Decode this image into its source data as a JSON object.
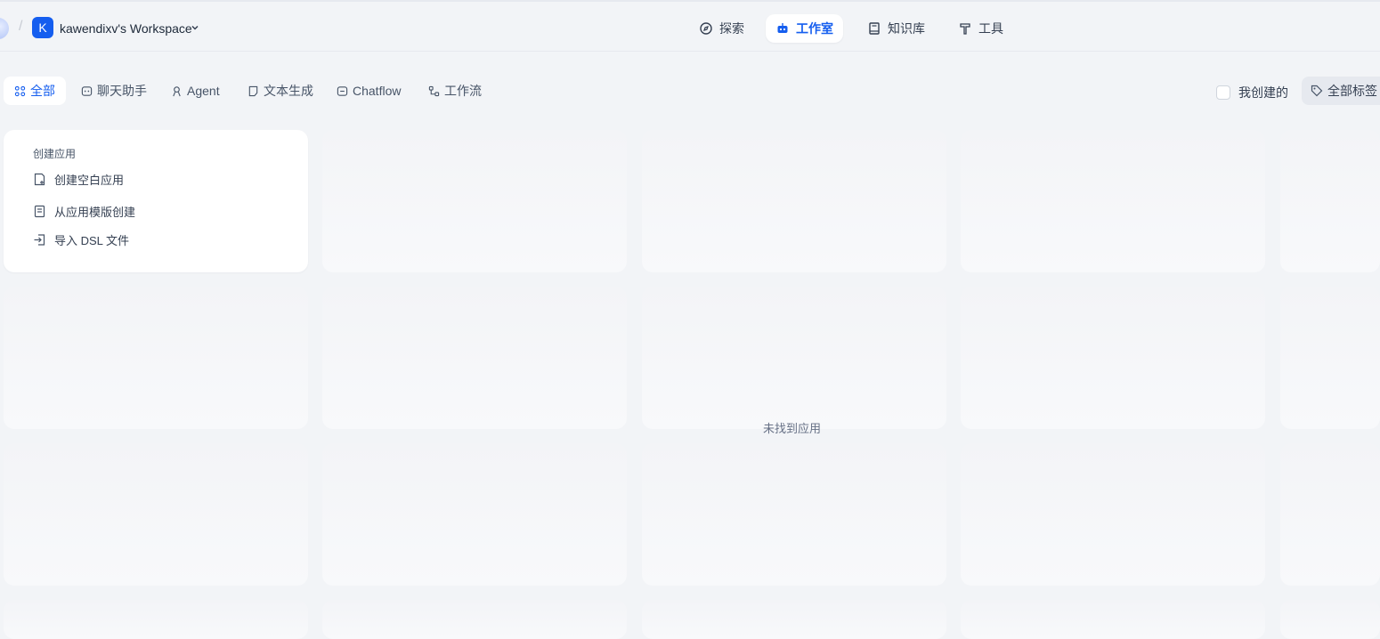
{
  "header": {
    "workspace_initial": "K",
    "workspace_name": "kawendixv's Workspace",
    "nav": [
      {
        "label": "探索",
        "icon": "compass-icon",
        "active": false
      },
      {
        "label": "工作室",
        "icon": "robot-icon",
        "active": true
      },
      {
        "label": "知识库",
        "icon": "book-icon",
        "active": false
      },
      {
        "label": "工具",
        "icon": "hammer-icon",
        "active": false
      }
    ]
  },
  "filters": {
    "tabs": [
      {
        "label": "全部",
        "icon": "grid-icon",
        "active": true
      },
      {
        "label": "聊天助手",
        "icon": "chat-bot-icon",
        "active": false
      },
      {
        "label": "Agent",
        "icon": "agent-icon",
        "active": false
      },
      {
        "label": "文本生成",
        "icon": "text-doc-icon",
        "active": false
      },
      {
        "label": "Chatflow",
        "icon": "chatflow-icon",
        "active": false
      },
      {
        "label": "工作流",
        "icon": "workflow-icon",
        "active": false
      }
    ],
    "mine_label": "我创建的",
    "tags_label": "全部标签"
  },
  "create_card": {
    "title": "创建应用",
    "items": [
      {
        "label": "创建空白应用",
        "icon": "new-file-icon"
      },
      {
        "label": "从应用模版创建",
        "icon": "template-icon"
      },
      {
        "label": "导入 DSL 文件",
        "icon": "import-icon"
      }
    ]
  },
  "empty_state": "未找到应用",
  "colors": {
    "accent": "#155eef",
    "background": "#f2f4f7"
  }
}
